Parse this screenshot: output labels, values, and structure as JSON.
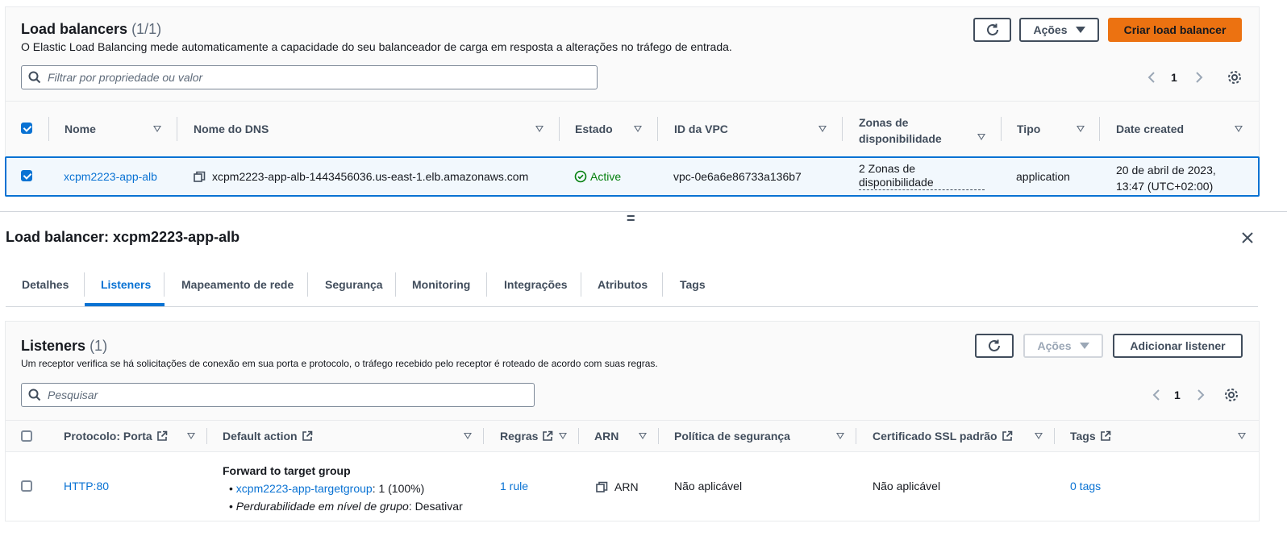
{
  "lb_panel": {
    "title": "Load balancers",
    "count": "(1/1)",
    "description": "O Elastic Load Balancing mede automaticamente a capacidade do seu balanceador de carga em resposta a alterações no tráfego de entrada.",
    "actions_label": "Ações",
    "create_label": "Criar load balancer",
    "filter_placeholder": "Filtrar por propriedade ou valor",
    "page": "1",
    "columns": [
      "Nome",
      "Nome do DNS",
      "Estado",
      "ID da VPC",
      "Zonas de disponibilidade",
      "Tipo",
      "Date created"
    ],
    "zones_col": [
      "Zonas de",
      "disponibilidade"
    ],
    "row": {
      "name": "xcpm2223-app-alb",
      "dns": "xcpm2223-app-alb-1443456036.us-east-1.elb.amazonaws.com",
      "status": "Active",
      "vpc": "vpc-0e6a6e86733a136b7",
      "zones_line1": "2 Zonas de",
      "zones_line2": "disponibilidade",
      "type": "application",
      "date_line1": "20 de abril de 2023,",
      "date_line2": "13:47 (UTC+02:00)"
    }
  },
  "splitter": "=",
  "details": {
    "title": "Load balancer: xcpm2223-app-alb",
    "tabs": [
      "Detalhes",
      "Listeners",
      "Mapeamento de rede",
      "Segurança",
      "Monitoring",
      "Integrações",
      "Atributos",
      "Tags"
    ],
    "active_tab": "Listeners"
  },
  "listeners": {
    "title": "Listeners",
    "count": "(1)",
    "description": "Um receptor verifica se há solicitações de conexão em sua porta e protocolo, o tráfego recebido pelo receptor é roteado de acordo com suas regras.",
    "actions_label": "Ações",
    "add_label": "Adicionar listener",
    "search_placeholder": "Pesquisar",
    "page": "1",
    "columns": [
      "Protocolo: Porta",
      "Default action",
      "Regras",
      "ARN",
      "Política de segurança",
      "Certificado SSL padrão",
      "Tags"
    ],
    "row": {
      "protocol": "HTTP:80",
      "action_title": "Forward to target group",
      "target_group": "xcpm2223-app-targetgroup",
      "target_weight": ": 1 (100%)",
      "stickiness_label": "Perdurabilidade em nível de grupo",
      "stickiness_value": ": Desativar",
      "rules": "1 rule",
      "arn": "ARN",
      "policy": "Não aplicável",
      "cert": "Não aplicável",
      "tags": "0 tags"
    }
  },
  "colors": {
    "accent": "#0972d3",
    "primary_button": "#ec7211",
    "success": "#037f0c",
    "selected_row_bg": "#f2f8fd"
  }
}
